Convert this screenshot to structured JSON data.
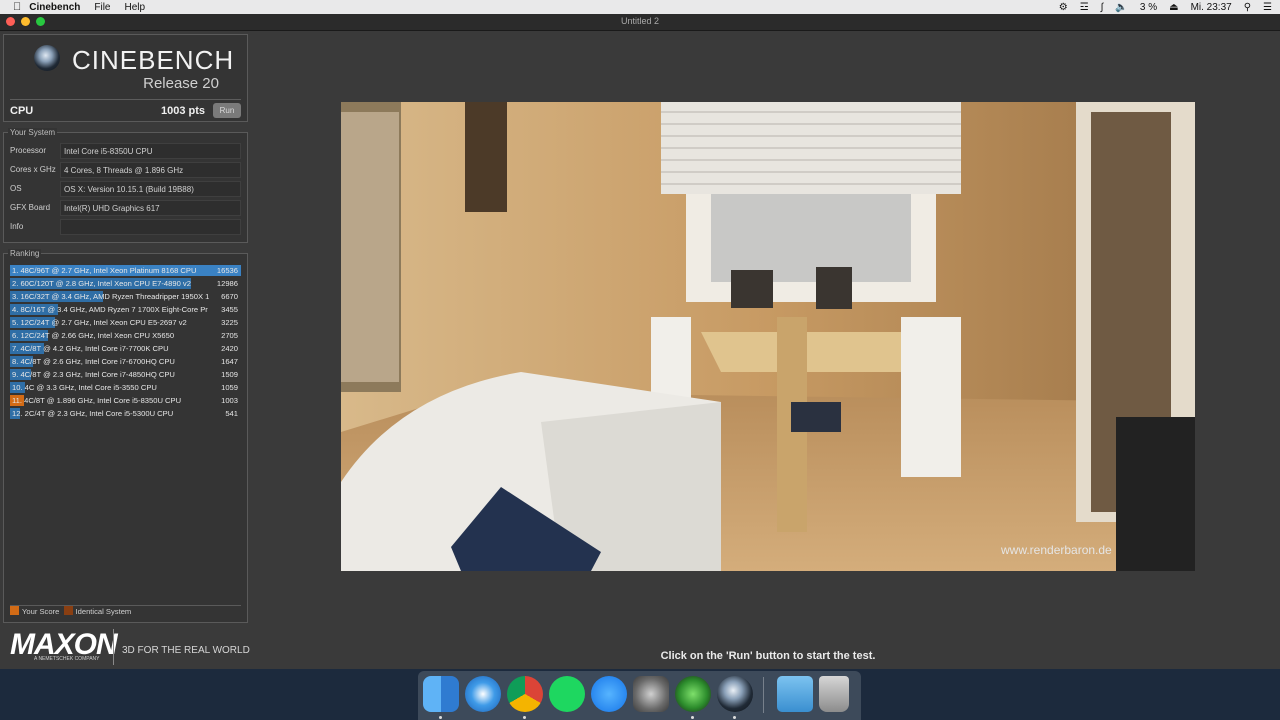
{
  "menubar": {
    "app": "Cinebench",
    "items": [
      "File",
      "Help"
    ],
    "battery": "3 %",
    "clock": "Mi. 23:37"
  },
  "window": {
    "title": "Untitled 2"
  },
  "header": {
    "brand": "CINEBENCH",
    "release": "Release 20",
    "cpu_label": "CPU",
    "cpu_score": "1003 pts",
    "run_label": "Run"
  },
  "system": {
    "section": "Your System",
    "rows": [
      {
        "key": "Processor",
        "value": "Intel Core i5-8350U CPU"
      },
      {
        "key": "Cores x GHz",
        "value": "4 Cores, 8 Threads @ 1.896 GHz"
      },
      {
        "key": "OS",
        "value": "OS X: Version 10.15.1 (Build 19B88)"
      },
      {
        "key": "GFX Board",
        "value": "Intel(R) UHD Graphics 617"
      },
      {
        "key": "Info",
        "value": ""
      }
    ]
  },
  "ranking": {
    "section": "Ranking",
    "rows": [
      {
        "label": "1. 48C/96T @ 2.7 GHz, Intel Xeon Platinum 8168 CPU",
        "score": "16536",
        "value": 16536
      },
      {
        "label": "2. 60C/120T @ 2.8 GHz, Intel Xeon CPU E7-4890 v2",
        "score": "12986",
        "value": 12986
      },
      {
        "label": "3. 16C/32T @ 3.4 GHz, AMD Ryzen Threadripper 1950X 1",
        "score": "6670",
        "value": 6670
      },
      {
        "label": "4. 8C/16T @ 3.4 GHz, AMD Ryzen 7 1700X Eight-Core Pr",
        "score": "3455",
        "value": 3455
      },
      {
        "label": "5. 12C/24T @ 2.7 GHz, Intel Xeon CPU E5-2697 v2",
        "score": "3225",
        "value": 3225
      },
      {
        "label": "6. 12C/24T @ 2.66 GHz, Intel Xeon CPU X5650",
        "score": "2705",
        "value": 2705
      },
      {
        "label": "7. 4C/8T @ 4.2 GHz, Intel Core i7-7700K CPU",
        "score": "2420",
        "value": 2420
      },
      {
        "label": "8. 4C/8T @ 2.6 GHz, Intel Core i7-6700HQ CPU",
        "score": "1647",
        "value": 1647
      },
      {
        "label": "9. 4C/8T @ 2.3 GHz, Intel Core i7-4850HQ CPU",
        "score": "1509",
        "value": 1509
      },
      {
        "label": "10. 4C @ 3.3 GHz, Intel Core i5-3550 CPU",
        "score": "1059",
        "value": 1059
      },
      {
        "label": "11. 4C/8T @ 1.896 GHz, Intel Core i5-8350U CPU",
        "score": "1003",
        "value": 1003,
        "mine": true
      },
      {
        "label": "12. 2C/4T @ 2.3 GHz, Intel Core i5-5300U CPU",
        "score": "541",
        "value": 541
      }
    ],
    "legend_your_score": "Your Score",
    "legend_identical": "Identical System",
    "colors": {
      "bar": "#2f6ea6",
      "mine": "#d26b16",
      "identical": "#8a3f12"
    }
  },
  "brand_footer": {
    "maxon": "MAXON",
    "maxon_sub": "A NEMETSCHEK COMPANY",
    "tagline": "3D FOR THE REAL WORLD"
  },
  "render": {
    "watermark": "www.renderbaron.de"
  },
  "hint": "Click on the 'Run' button to start the test.",
  "dock": {
    "icons": [
      "finder-icon",
      "safari-icon",
      "chrome-icon",
      "spotify-icon",
      "app-store-icon",
      "system-preferences-icon",
      "clover-icon",
      "cinebench-icon",
      "downloads-folder-icon",
      "trash-icon"
    ]
  }
}
